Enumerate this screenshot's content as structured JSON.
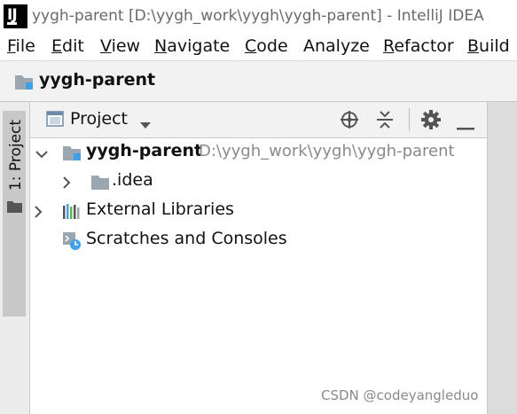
{
  "window": {
    "app_icon": "intellij-icon",
    "title": "yygh-parent [D:\\yygh_work\\yygh\\yygh-parent] - IntelliJ IDEA"
  },
  "menu": [
    {
      "mnemonic": "F",
      "rest": "ile"
    },
    {
      "mnemonic": "E",
      "rest": "dit"
    },
    {
      "mnemonic": "V",
      "rest": "iew"
    },
    {
      "mnemonic": "N",
      "rest": "avigate"
    },
    {
      "mnemonic": "C",
      "rest": "ode"
    },
    {
      "mnemonic": "",
      "rest": "Analyze"
    },
    {
      "mnemonic": "R",
      "rest": "efactor"
    },
    {
      "mnemonic": "B",
      "rest": "uild"
    }
  ],
  "navbar": {
    "label": "yygh-parent",
    "icon": "module-folder-icon"
  },
  "tool_window_strip": {
    "project_tab_label": "1: Project",
    "icon": "folder-icon"
  },
  "project_panel": {
    "title": "Project",
    "icons": [
      "locate-icon",
      "collapse-all-icon",
      "gear-icon",
      "minimize-icon"
    ]
  },
  "tree": {
    "root": {
      "label": "yygh-parent",
      "path": "D:\\yygh_work\\yygh\\yygh-parent",
      "expanded": true
    },
    "child": {
      "label": ".idea",
      "expanded": false
    },
    "external_libraries": {
      "label": "External Libraries",
      "expanded": false
    },
    "scratches": {
      "label": "Scratches and Consoles"
    }
  },
  "watermark": "CSDN @codeyangleduo",
  "colors": {
    "folder": "#9aa7b0",
    "module_blue": "#40a0e8",
    "tab_selected": "#c8c8c8",
    "panel_bg": "#f2f2f2"
  }
}
